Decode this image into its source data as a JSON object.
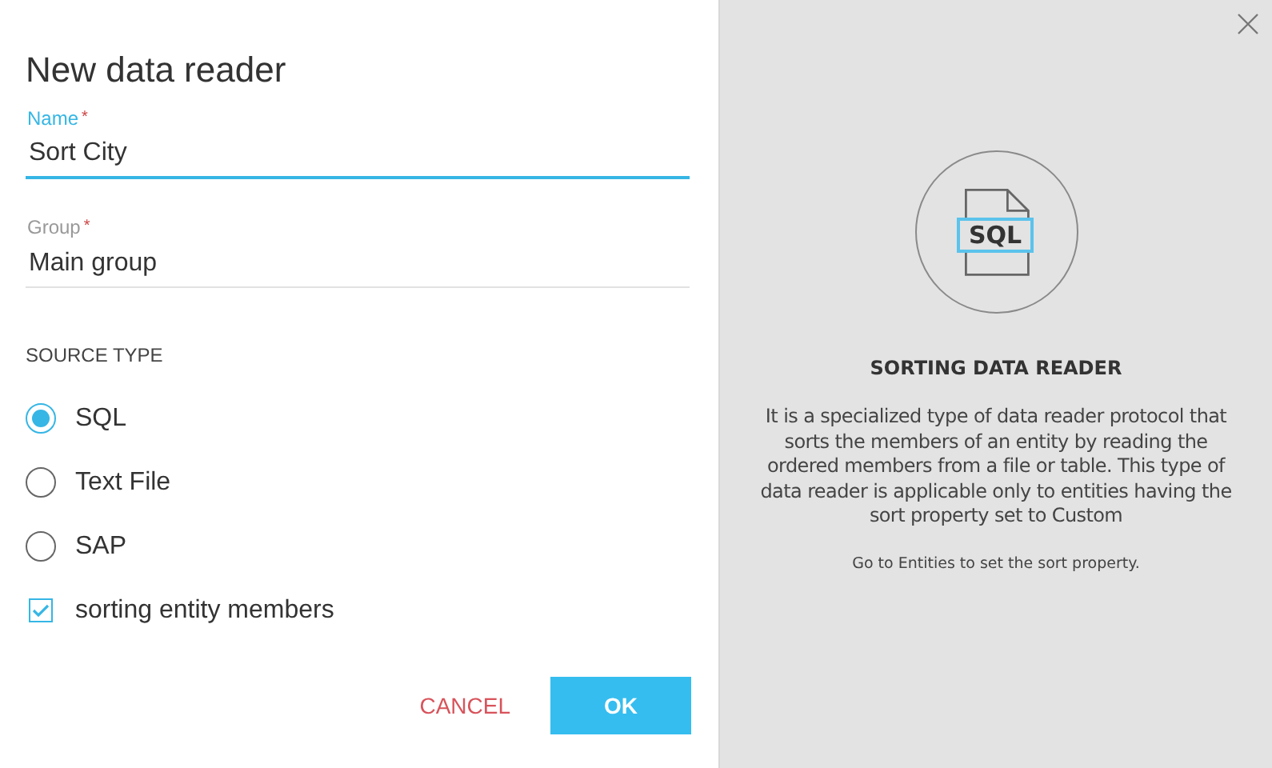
{
  "dialog": {
    "title": "New data reader"
  },
  "fields": [
    {
      "label": "Name",
      "required_mark": "*",
      "value": "Sort City",
      "focused": true
    },
    {
      "label": "Group",
      "required_mark": "*",
      "value": "Main group",
      "focused": false
    }
  ],
  "source_type": {
    "heading": "SOURCE TYPE",
    "options": [
      {
        "label": "SQL",
        "selected": true
      },
      {
        "label": "Text File",
        "selected": false
      },
      {
        "label": "SAP",
        "selected": false
      }
    ]
  },
  "sorting_option": {
    "label": "sorting entity members",
    "checked": true
  },
  "buttons": [
    {
      "label": "CANCEL",
      "kind": "text"
    },
    {
      "label": "OK",
      "kind": "primary"
    }
  ],
  "info_panel": {
    "icon_label": "SQL",
    "title": "SORTING DATA READER",
    "description": "It is a specialized type of data reader protocol that sorts the members of an entity by reading the ordered members from a file or table. This type of data reader is applicable only to entities having the sort property set to Custom",
    "note": "Go to Entities to set the sort property."
  }
}
